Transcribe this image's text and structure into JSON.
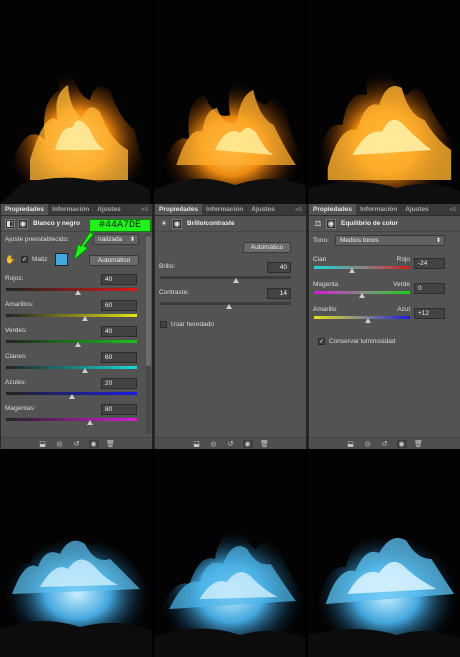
{
  "top_images": [
    "orange-flame-1",
    "orange-flame-2",
    "orange-flame-3"
  ],
  "bottom_images": [
    "blue-flame-1",
    "blue-flame-2",
    "blue-flame-3"
  ],
  "tabs": {
    "properties": "Propiedades",
    "info": "Información",
    "adjust": "Ajustes"
  },
  "callout": {
    "hex": "#44A7DE",
    "color": "#44A7DE"
  },
  "bw": {
    "title": "Blanco y negro",
    "preset_label": "Ajuste preestablecido:",
    "preset_value": "nalizada",
    "tint_label": "Matiz",
    "tint_checked": true,
    "auto_button": "Automático",
    "sliders": [
      {
        "label": "Rojos:",
        "value": "40",
        "pos": 0.55,
        "grad": "linear-gradient(90deg,#222,#d81919)"
      },
      {
        "label": "Amarillos:",
        "value": "60",
        "pos": 0.6,
        "grad": "linear-gradient(90deg,#222,#e4e417)"
      },
      {
        "label": "Verdes:",
        "value": "40",
        "pos": 0.55,
        "grad": "linear-gradient(90deg,#222,#19c419)"
      },
      {
        "label": "Cianes:",
        "value": "60",
        "pos": 0.6,
        "grad": "linear-gradient(90deg,#222,#17d9d9)"
      },
      {
        "label": "Azules:",
        "value": "20",
        "pos": 0.5,
        "grad": "linear-gradient(90deg,#222,#1b1be4)"
      },
      {
        "label": "Magentas:",
        "value": "80",
        "pos": 0.64,
        "grad": "linear-gradient(90deg,#222,#d71bd7)"
      }
    ]
  },
  "bc": {
    "title": "Brillo/contraste",
    "auto_button": "Automático",
    "brightness_label": "Brillo:",
    "brightness_value": "40",
    "brightness_pos": 0.58,
    "contrast_label": "Contraste:",
    "contrast_value": "14",
    "contrast_pos": 0.53,
    "legacy_label": "Usar heredado",
    "legacy_checked": false
  },
  "cb": {
    "title": "Equilibrio de color",
    "tone_label": "Tono:",
    "tone_value": "Medios tonos",
    "sliders": [
      {
        "left": "Cian",
        "right": "Rojo",
        "value": "-24",
        "pos": 0.4,
        "grad": "linear-gradient(90deg,#1bd6d6,#888,#d21b1b)"
      },
      {
        "left": "Magenta",
        "right": "Verde",
        "value": "0",
        "pos": 0.5,
        "grad": "linear-gradient(90deg,#d21bd2,#888,#1bd21b)"
      },
      {
        "left": "Amarillo",
        "right": "Azul",
        "value": "+12",
        "pos": 0.56,
        "grad": "linear-gradient(90deg,#e3e31b,#888,#1b1be3)"
      }
    ],
    "preserve_label": "Conservar luminosidad",
    "preserve_checked": true
  },
  "footer_icons": [
    "clip-to-layer-icon",
    "view-previous-icon",
    "reset-icon",
    "visibility-icon",
    "delete-icon"
  ]
}
